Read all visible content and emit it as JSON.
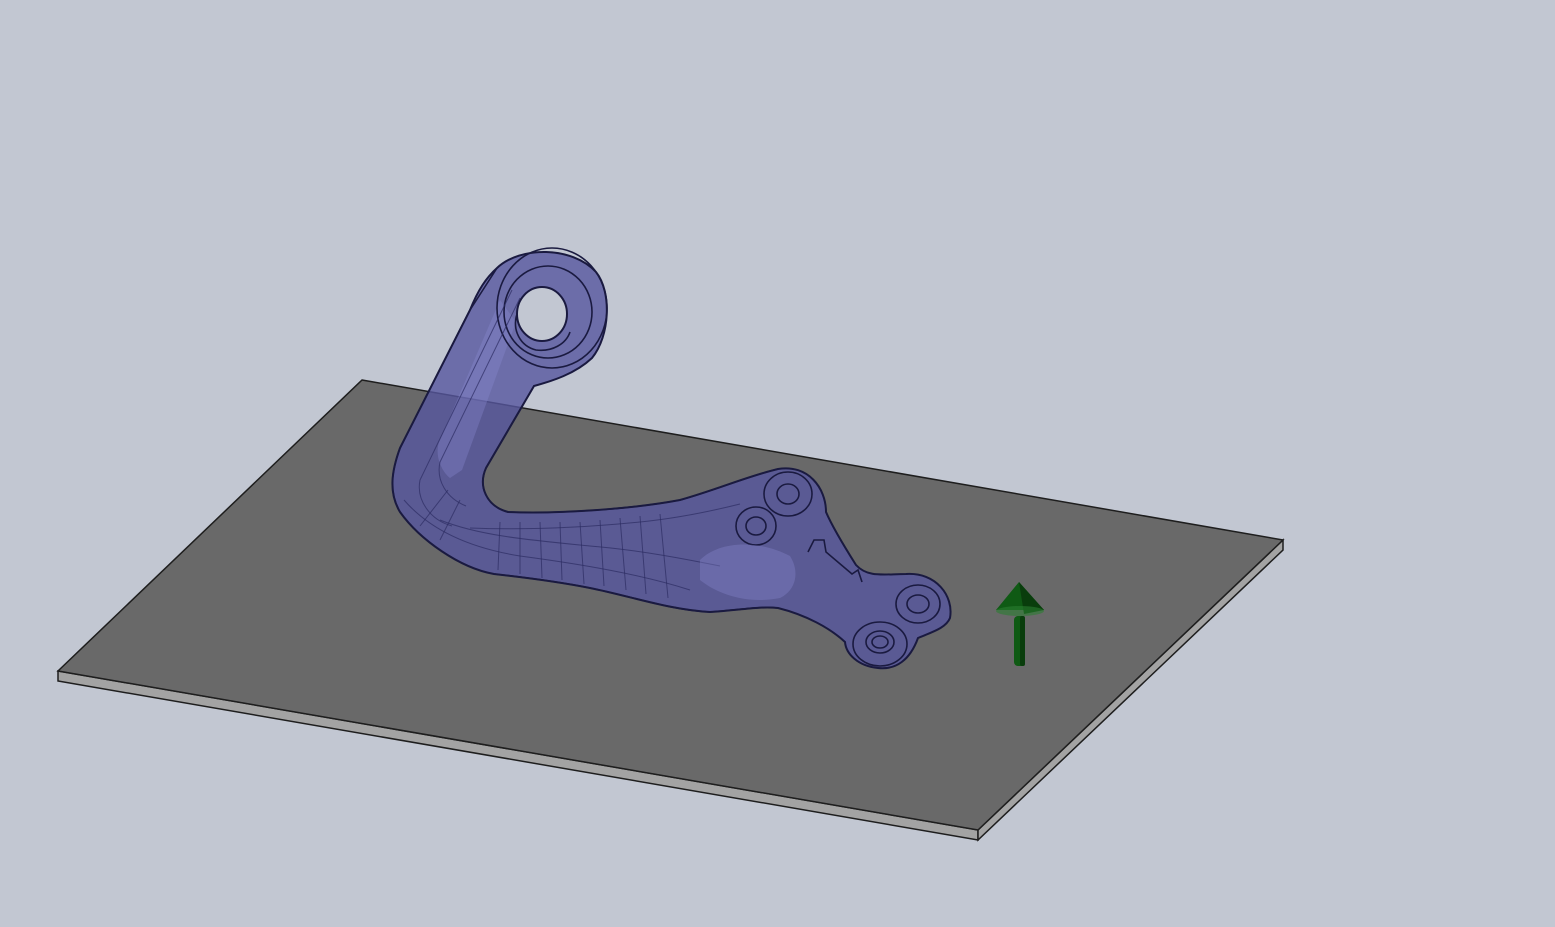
{
  "viewport": {
    "background_color": "#c2c7d2"
  },
  "model": {
    "plate": {
      "top_color": "#696969",
      "edge_color": "#a3a3a3",
      "outline_color": "#1e1e1e"
    },
    "part": {
      "fill_color": "#56569f",
      "fill_opacity": 0.8,
      "edge_color": "#1a1a40",
      "hidden_edge_color": "#2c2c63",
      "highlight_color": "#8a8ad0",
      "bore_color": "#c2c7d2"
    },
    "direction_arrow": {
      "icon": "arrow-up-icon",
      "color": "#0f5a14",
      "dark_color": "#093d0c",
      "light_color": "#2a7d30"
    }
  }
}
